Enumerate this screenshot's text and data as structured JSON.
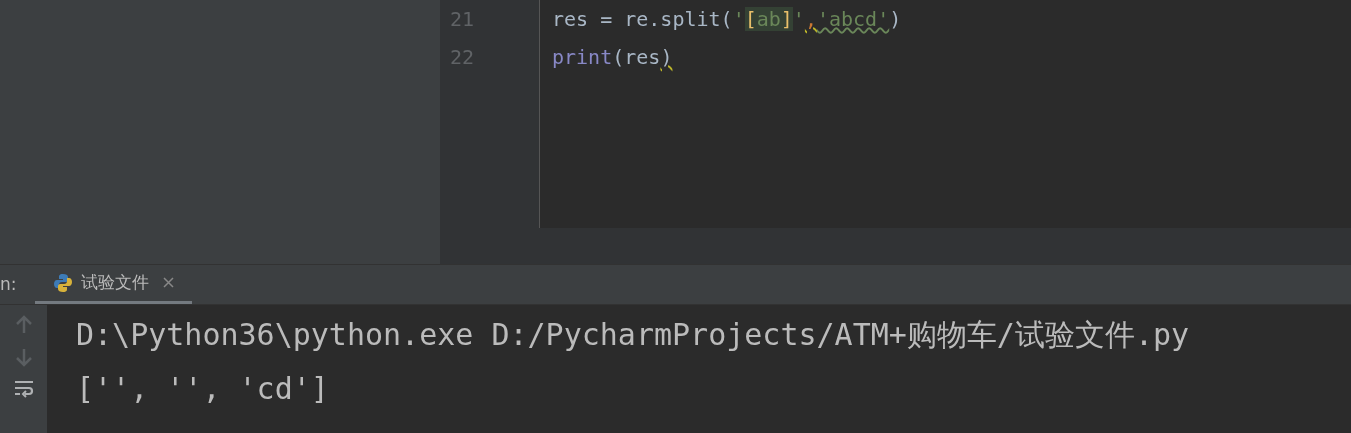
{
  "editor": {
    "lines": [
      {
        "number": "21",
        "tokens": [
          {
            "text": "res = re.split(",
            "kind": "plain"
          },
          {
            "text": "'",
            "kind": "string"
          },
          {
            "text": "[",
            "kind": "bracket"
          },
          {
            "text": "ab",
            "kind": "regex"
          },
          {
            "text": "]",
            "kind": "bracket"
          },
          {
            "text": "'",
            "kind": "string"
          },
          {
            "text": ",",
            "kind": "warning"
          },
          {
            "text": "'abcd'",
            "kind": "typo"
          },
          {
            "text": ")",
            "kind": "plain"
          }
        ]
      },
      {
        "number": "22",
        "tokens": [
          {
            "text": "print",
            "kind": "builtin"
          },
          {
            "text": "(res",
            "kind": "plain"
          },
          {
            "text": ")",
            "kind": "weak-warning"
          }
        ]
      }
    ]
  },
  "run_panel": {
    "label": "n:",
    "tabs": [
      {
        "label": "试验文件",
        "selected": true
      }
    ],
    "console": [
      "D:\\Python36\\python.exe D:/PycharmProjects/ATM+购物车/试验文件.py",
      "['', '', 'cd']"
    ]
  }
}
